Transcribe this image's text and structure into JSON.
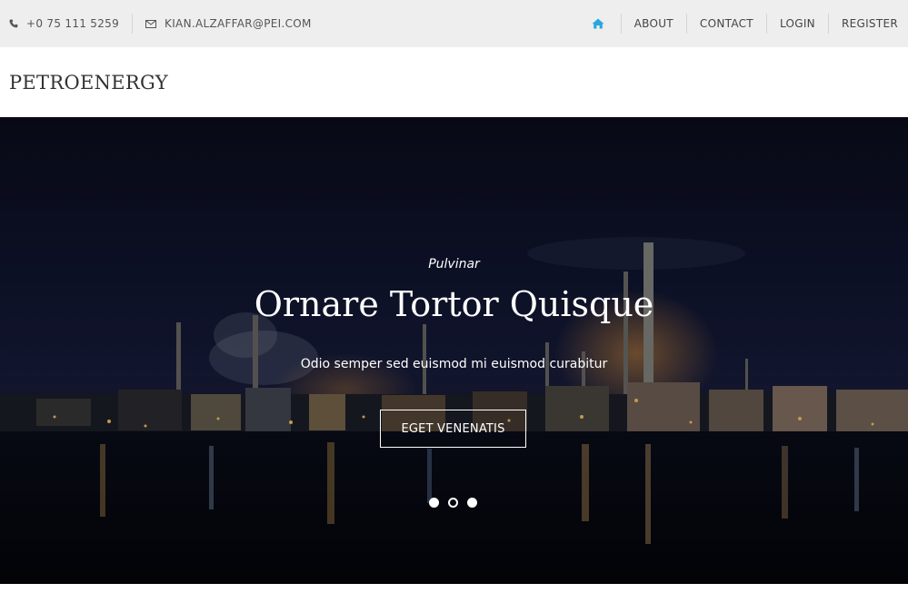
{
  "topbar": {
    "phone": "+0 75 111 5259",
    "email": "KIAN.ALZAFFAR@PEI.COM",
    "nav": [
      {
        "label": "ABOUT"
      },
      {
        "label": "CONTACT"
      },
      {
        "label": "LOGIN"
      },
      {
        "label": "REGISTER"
      }
    ],
    "home_icon": "home-icon",
    "phone_icon": "phone-icon",
    "email_icon": "envelope-icon"
  },
  "brand": {
    "name": "PETROENERGY"
  },
  "hero": {
    "kicker": "Pulvinar",
    "title": "Ornare Tortor Quisque",
    "subtitle": "Odio semper sed euismod mi euismod curabitur",
    "button_label": "EGET VENENATIS",
    "slides_total": 3,
    "active_slide": 2
  },
  "colors": {
    "accent": "#2aa6e0",
    "topbar_bg": "#eeeeee",
    "text_dark": "#333333"
  }
}
